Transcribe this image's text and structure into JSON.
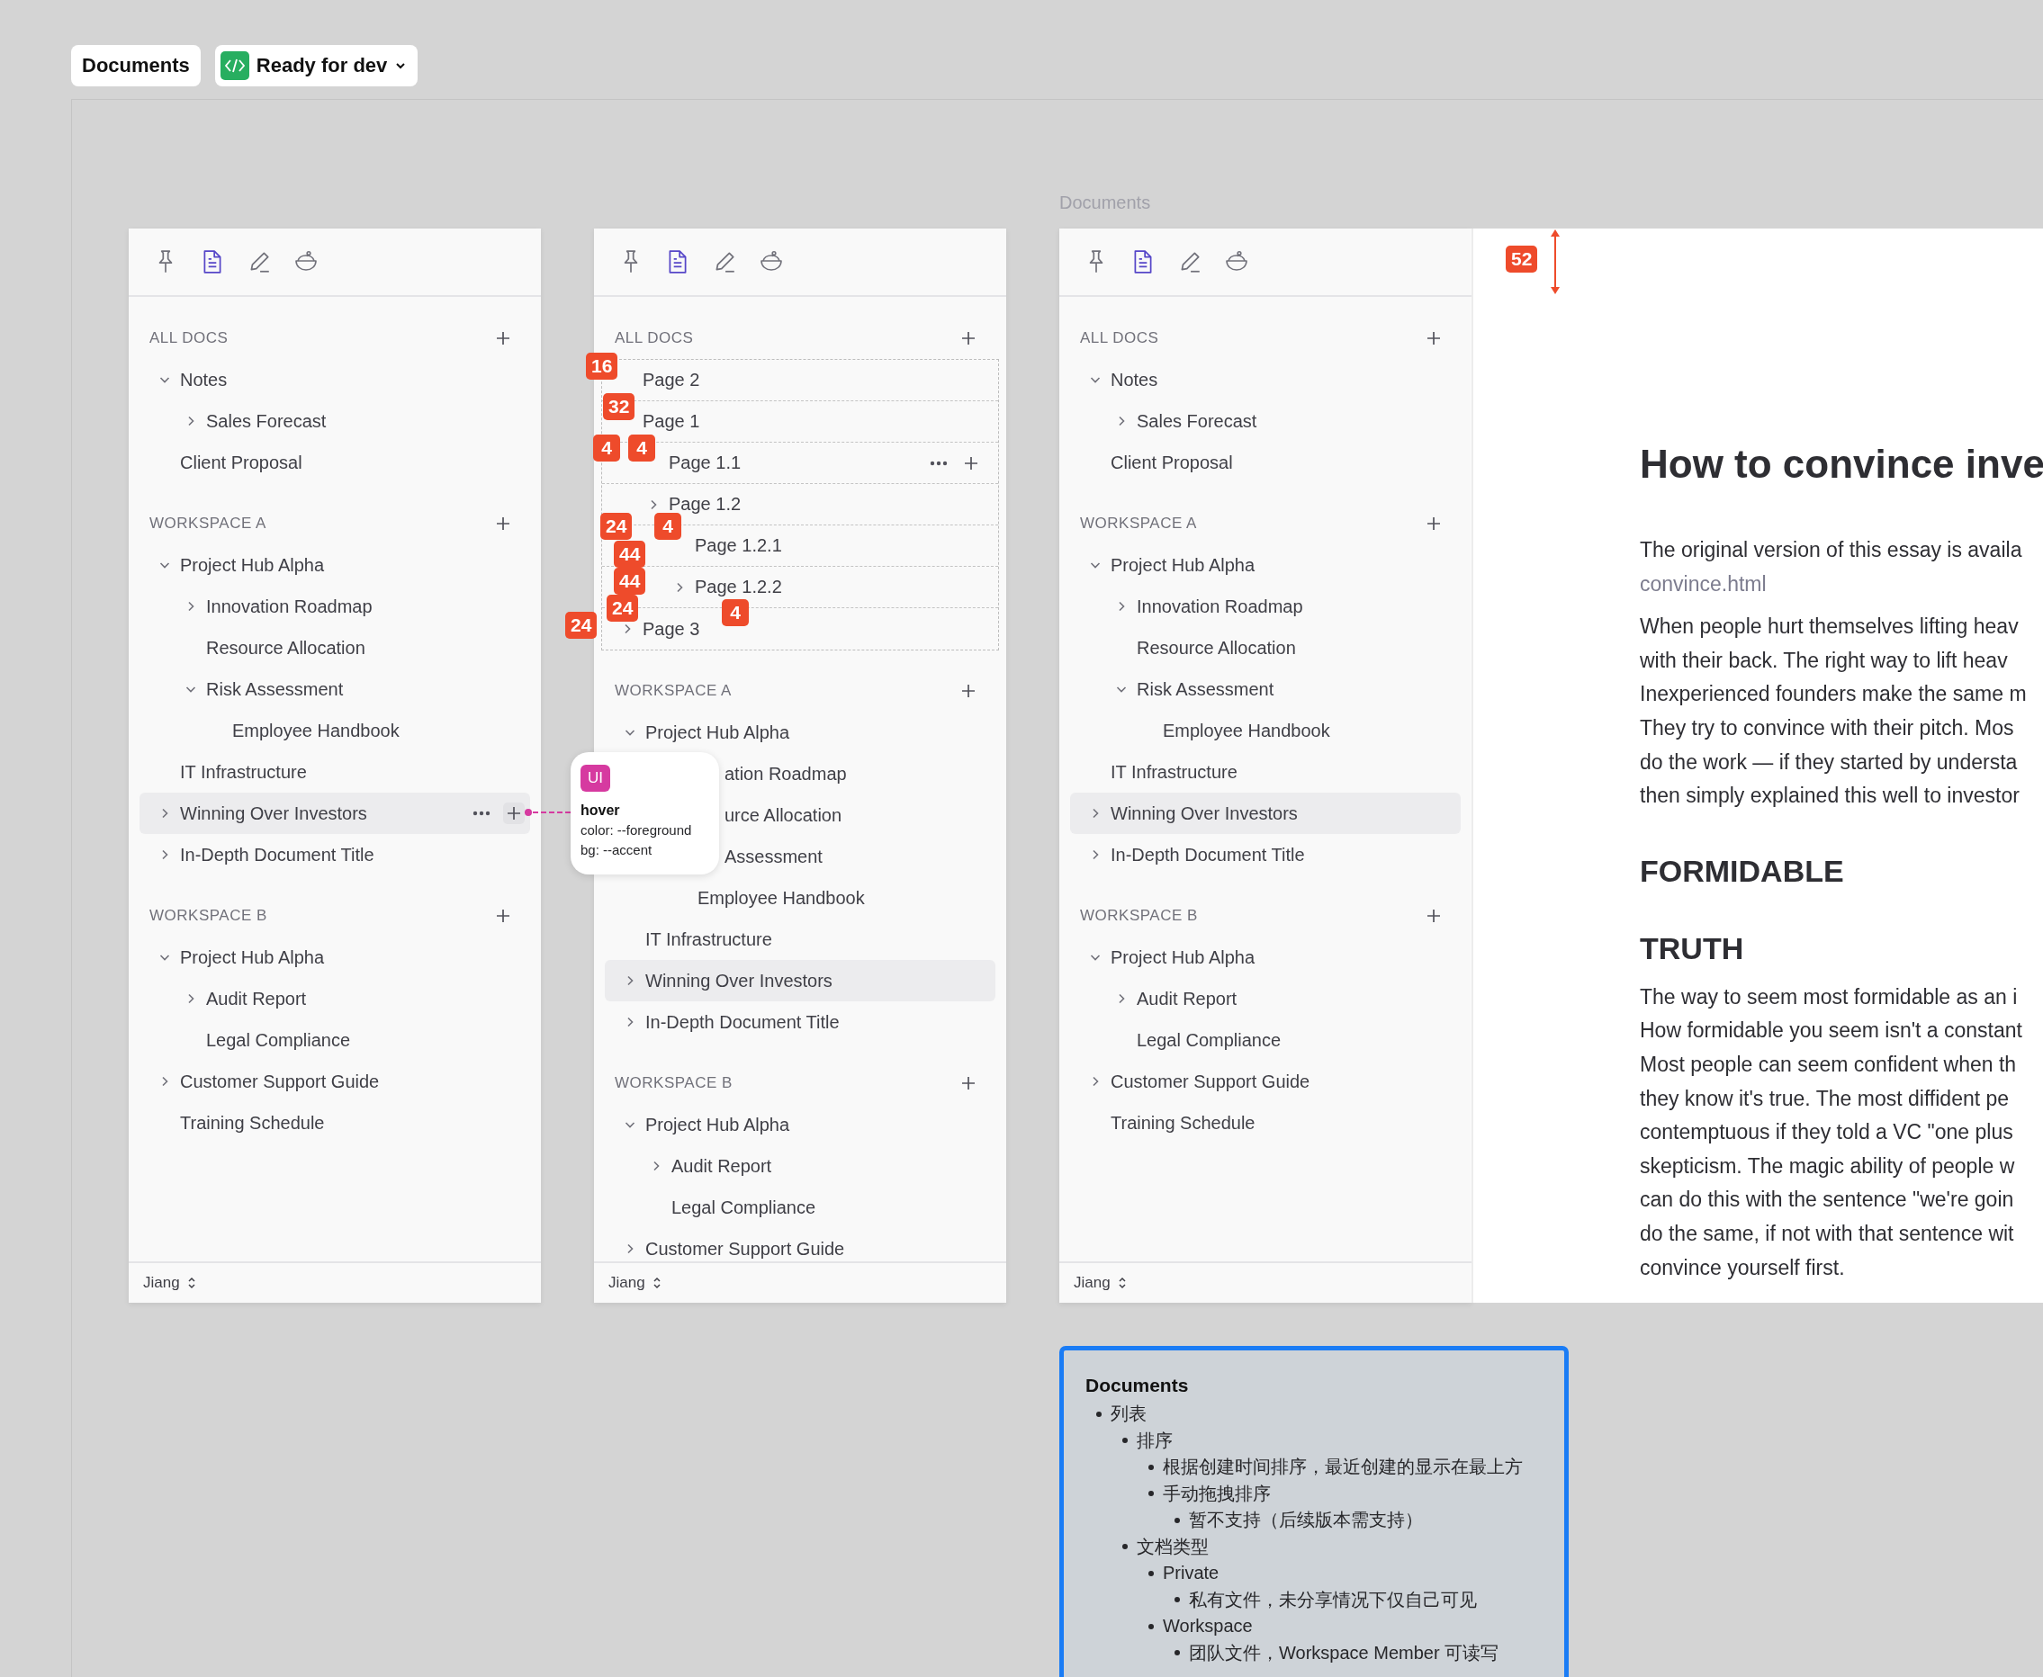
{
  "toolbar": {
    "frame_button": "Documents",
    "status": "Ready for dev"
  },
  "frame_label": "Documents",
  "panels": [
    {
      "tabs": [
        {
          "kind": "pin",
          "selected": false
        },
        {
          "kind": "doc",
          "selected": true
        },
        {
          "kind": "pen",
          "selected": false
        },
        {
          "kind": "bowl",
          "selected": false
        }
      ],
      "sections": [
        {
          "title": "ALL DOCS",
          "kind": "plain",
          "items": [
            {
              "label": "Notes",
              "kind": "group",
              "expanded": true,
              "hovered": false,
              "children": [
                {
                  "label": "Sales Forecast",
                  "kind": "group",
                  "expanded": false,
                  "hovered": false
                }
              ]
            },
            {
              "label": "Client Proposal",
              "kind": "plain",
              "hovered": false
            }
          ]
        },
        {
          "title": "WORKSPACE A",
          "kind": "plain",
          "items": [
            {
              "label": "Project Hub Alpha",
              "kind": "group",
              "expanded": true,
              "hovered": false,
              "children": [
                {
                  "label": "Innovation Roadmap",
                  "kind": "group",
                  "expanded": false,
                  "hovered": false
                },
                {
                  "label": "Resource Allocation",
                  "kind": "plain",
                  "hovered": false
                },
                {
                  "label": "Risk Assessment",
                  "kind": "group",
                  "expanded": true,
                  "hovered": false,
                  "children": [
                    {
                      "label": "Employee Handbook",
                      "kind": "plain",
                      "hovered": false
                    }
                  ]
                }
              ]
            },
            {
              "label": "IT Infrastructure",
              "kind": "plain",
              "hovered": false
            },
            {
              "label": "Winning Over Investors",
              "kind": "group",
              "expanded": false,
              "hovered": true,
              "actions": true
            },
            {
              "label": "In-Depth Document Title",
              "kind": "group",
              "expanded": false,
              "hovered": false
            }
          ]
        },
        {
          "title": "WORKSPACE B",
          "kind": "plain",
          "items": [
            {
              "label": "Project Hub Alpha",
              "kind": "group",
              "expanded": true,
              "hovered": false,
              "children": [
                {
                  "label": "Audit Report",
                  "kind": "group",
                  "expanded": false,
                  "hovered": false
                },
                {
                  "label": "Legal Compliance",
                  "kind": "plain",
                  "hovered": false
                }
              ]
            },
            {
              "label": "Customer Support Guide",
              "kind": "group",
              "expanded": false,
              "hovered": false
            },
            {
              "label": "Training Schedule",
              "kind": "plain",
              "hovered": false
            }
          ]
        }
      ],
      "user": "Jiang"
    },
    {
      "tabs": [
        {
          "kind": "pin",
          "selected": false
        },
        {
          "kind": "doc",
          "selected": true
        },
        {
          "kind": "pen",
          "selected": false
        },
        {
          "kind": "bowl",
          "selected": false
        }
      ],
      "sections": [
        {
          "title": "ALL DOCS",
          "kind": "spec",
          "items": [
            {
              "label": "Page 2",
              "kind": "plain",
              "hovered": false
            },
            {
              "label": "Page 1",
              "kind": "plain",
              "hovered": false,
              "children": [
                {
                  "label": "Page 1.1",
                  "kind": "plain",
                  "hovered": false,
                  "actions": true
                },
                {
                  "label": "Page 1.2",
                  "kind": "group",
                  "expanded": false,
                  "hovered": false,
                  "children": [
                    {
                      "label": "Page 1.2.1",
                      "kind": "plain",
                      "hovered": false
                    },
                    {
                      "label": "Page 1.2.2",
                      "kind": "group",
                      "expanded": false,
                      "hovered": false
                    }
                  ]
                }
              ]
            },
            {
              "label": "Page 3",
              "kind": "group",
              "expanded": false,
              "hovered": false
            }
          ]
        },
        {
          "title": "WORKSPACE A",
          "kind": "plain",
          "items": [
            {
              "label": "Project Hub Alpha",
              "kind": "group",
              "expanded": true,
              "hovered": false,
              "children": [
                {
                  "label": "ation Roadmap",
                  "kind": "partial",
                  "hovered": false
                },
                {
                  "label": "urce Allocation",
                  "kind": "partial",
                  "hovered": false
                },
                {
                  "label": "Assessment",
                  "kind": "partial",
                  "hovered": false,
                  "children": [
                    {
                      "label": "Employee Handbook",
                      "kind": "plain",
                      "hovered": false
                    }
                  ]
                }
              ]
            },
            {
              "label": "IT Infrastructure",
              "kind": "plain",
              "hovered": false
            },
            {
              "label": "Winning Over Investors",
              "kind": "group",
              "expanded": false,
              "hovered": true
            },
            {
              "label": "In-Depth Document Title",
              "kind": "group",
              "expanded": false,
              "hovered": false
            }
          ]
        },
        {
          "title": "WORKSPACE B",
          "kind": "plain",
          "items": [
            {
              "label": "Project Hub Alpha",
              "kind": "group",
              "expanded": true,
              "hovered": false,
              "children": [
                {
                  "label": "Audit Report",
                  "kind": "group",
                  "expanded": false,
                  "hovered": false
                },
                {
                  "label": "Legal Compliance",
                  "kind": "plain",
                  "hovered": false
                }
              ]
            },
            {
              "label": "Customer Support Guide",
              "kind": "group",
              "expanded": false,
              "hovered": false
            }
          ]
        }
      ],
      "user": "Jiang",
      "spec_badges": [
        "16",
        "32",
        "4",
        "4",
        "24",
        "4",
        "44",
        "44",
        "24",
        "24",
        "4"
      ]
    },
    {
      "tabs": [
        {
          "kind": "pin",
          "selected": false
        },
        {
          "kind": "doc",
          "selected": true
        },
        {
          "kind": "pen",
          "selected": false
        },
        {
          "kind": "bowl",
          "selected": false
        }
      ],
      "sections": [
        {
          "title": "ALL DOCS",
          "kind": "plain",
          "items": [
            {
              "label": "Notes",
              "kind": "group",
              "expanded": true,
              "hovered": false,
              "children": [
                {
                  "label": "Sales Forecast",
                  "kind": "group",
                  "expanded": false,
                  "hovered": false
                }
              ]
            },
            {
              "label": "Client Proposal",
              "kind": "plain",
              "hovered": false
            }
          ]
        },
        {
          "title": "WORKSPACE A",
          "kind": "plain",
          "items": [
            {
              "label": "Project Hub Alpha",
              "kind": "group",
              "expanded": true,
              "hovered": false,
              "children": [
                {
                  "label": "Innovation Roadmap",
                  "kind": "group",
                  "expanded": false,
                  "hovered": false
                },
                {
                  "label": "Resource Allocation",
                  "kind": "plain",
                  "hovered": false
                },
                {
                  "label": "Risk Assessment",
                  "kind": "group",
                  "expanded": true,
                  "hovered": false,
                  "children": [
                    {
                      "label": "Employee Handbook",
                      "kind": "plain",
                      "hovered": false
                    }
                  ]
                }
              ]
            },
            {
              "label": "IT Infrastructure",
              "kind": "plain",
              "hovered": false
            },
            {
              "label": "Winning Over Investors",
              "kind": "group",
              "expanded": false,
              "hovered": true
            },
            {
              "label": "In-Depth Document Title",
              "kind": "group",
              "expanded": false,
              "hovered": false
            }
          ]
        },
        {
          "title": "WORKSPACE B",
          "kind": "plain",
          "items": [
            {
              "label": "Project Hub Alpha",
              "kind": "group",
              "expanded": true,
              "hovered": false,
              "children": [
                {
                  "label": "Audit Report",
                  "kind": "group",
                  "expanded": false,
                  "hovered": false
                },
                {
                  "label": "Legal Compliance",
                  "kind": "plain",
                  "hovered": false
                }
              ]
            },
            {
              "label": "Customer Support Guide",
              "kind": "group",
              "expanded": false,
              "hovered": false
            },
            {
              "label": "Training Schedule",
              "kind": "plain",
              "hovered": false
            }
          ]
        }
      ],
      "user": "Jiang"
    }
  ],
  "tooltip": {
    "badge": "UI",
    "state": "hover",
    "lines": [
      "color: --foreground",
      "bg: --accent"
    ]
  },
  "document": {
    "spacing_badge": "52",
    "title": "How to convince inve",
    "blocks": [
      {
        "kind": "paragraph",
        "lines": [
          "The original version of this essay is availa"
        ]
      },
      {
        "kind": "link",
        "text": "convince.html"
      },
      {
        "kind": "paragraph",
        "lines": [
          "When people hurt themselves lifting heav",
          "with their back. The right way to lift heav",
          "Inexperienced founders make the same m",
          "They try to convince with their pitch. Mos",
          "do the work — if they started by understa",
          "then simply explained this well to investor"
        ]
      },
      {
        "kind": "heading",
        "text": "FORMIDABLE"
      },
      {
        "kind": "heading",
        "text": "TRUTH"
      },
      {
        "kind": "paragraph",
        "lines": [
          "The way to seem most formidable as an i",
          "How formidable you seem isn't a constant",
          "Most people can seem confident when th",
          "they know it's true. The most diffident pe",
          "contemptuous if they told a VC \"one plus",
          "skepticism. The magic ability of people w",
          "can do this with the sentence \"we're goin",
          "do the same, if not with that sentence wit",
          "convince yourself first."
        ]
      }
    ]
  },
  "note": {
    "title": "Documents",
    "items": [
      {
        "text": "列表",
        "children": [
          {
            "text": "排序",
            "children": [
              {
                "text": "根据创建时间排序，最近创建的显示在最上方"
              },
              {
                "text": "手动拖拽排序",
                "children": [
                  {
                    "text": "暂不支持（后续版本需支持）"
                  }
                ]
              }
            ]
          },
          {
            "text": "文档类型",
            "children": [
              {
                "text": "Private",
                "children": [
                  {
                    "text": "私有文件，未分享情况下仅自己可见"
                  }
                ]
              },
              {
                "text": "Workspace",
                "children": [
                  {
                    "text": "团队文件，Workspace Member 可读写"
                  }
                ]
              }
            ]
          }
        ]
      }
    ]
  }
}
